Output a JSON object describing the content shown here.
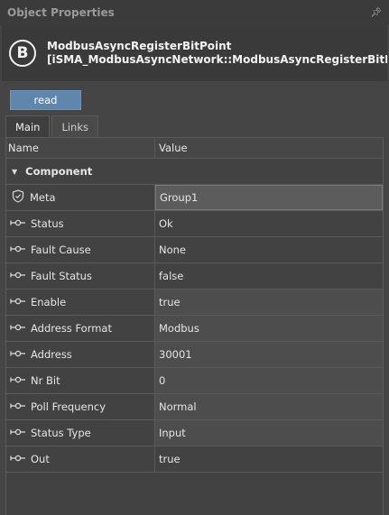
{
  "panel": {
    "title": "Object Properties",
    "pin_icon": "pin-icon"
  },
  "object": {
    "badge_letter": "B",
    "name": "ModbusAsyncRegisterBitPoint",
    "type_path": "[iSMA_ModbusAsyncNetwork::ModbusAsyncRegisterBitPoint"
  },
  "actions": {
    "read_label": "read"
  },
  "tabs": [
    {
      "label": "Main",
      "active": true
    },
    {
      "label": "Links",
      "active": false
    }
  ],
  "grid": {
    "header": {
      "name": "Name",
      "value": "Value"
    },
    "group": {
      "label": "Component"
    },
    "rows": [
      {
        "name": "Meta",
        "value": "Group1",
        "icon": "shield-icon"
      },
      {
        "name": "Status",
        "value": "Ok",
        "icon": "connector-icon"
      },
      {
        "name": "Fault Cause",
        "value": "None",
        "icon": "connector-icon"
      },
      {
        "name": "Fault Status",
        "value": "false",
        "icon": "connector-icon"
      },
      {
        "name": "Enable",
        "value": "true",
        "icon": "connector-icon"
      },
      {
        "name": "Address Format",
        "value": "Modbus",
        "icon": "connector-icon"
      },
      {
        "name": "Address",
        "value": "30001",
        "icon": "connector-icon"
      },
      {
        "name": "Nr Bit",
        "value": "0",
        "icon": "connector-icon"
      },
      {
        "name": "Poll Frequency",
        "value": "Normal",
        "icon": "connector-icon"
      },
      {
        "name": "Status Type",
        "value": "Input",
        "icon": "connector-icon"
      },
      {
        "name": "Out",
        "value": "true",
        "icon": "connector-icon"
      }
    ]
  }
}
